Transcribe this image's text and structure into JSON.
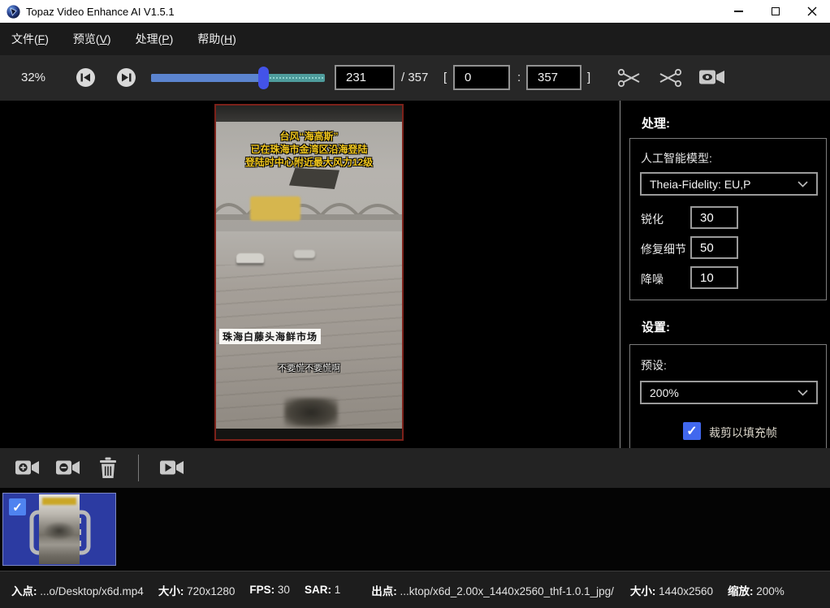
{
  "window": {
    "title": "Topaz Video Enhance AI V1.5.1"
  },
  "menu": {
    "items": [
      {
        "pre": "文件(",
        "key": "F",
        "post": ")"
      },
      {
        "pre": "预览(",
        "key": "V",
        "post": ")"
      },
      {
        "pre": "处理(",
        "key": "P",
        "post": ")"
      },
      {
        "pre": "帮助(",
        "key": "H",
        "post": ")"
      }
    ]
  },
  "toolbar": {
    "zoom_level": "32%",
    "current_frame": "231",
    "frame_total": "/ 357",
    "range_open": "[",
    "range_start": "0",
    "range_sep": ":",
    "range_end": "357",
    "range_close": "]"
  },
  "video_overlay": {
    "title_line1": "台风“海高斯”",
    "title_line2": "已在珠海市金湾区沿海登陆",
    "title_line3": "登陆时中心附近最大风力12级",
    "location_tag": "珠海白藤头海鲜市场",
    "caption": "不要慌不要慌啊"
  },
  "panel": {
    "processing_header": "处理:",
    "ai_model_label": "人工智能模型:",
    "ai_model_value": "Theia-Fidelity: EU,P",
    "params": [
      {
        "label": "锐化",
        "value": "30"
      },
      {
        "label": "修复细节",
        "value": "50"
      },
      {
        "label": "降噪",
        "value": "10"
      }
    ],
    "settings_header": "设置:",
    "preset_label": "预设:",
    "preset_value": "200%",
    "crop_to_fill_label": "裁剪以填充帧",
    "crop_to_fill_checked": true
  },
  "statusbar": {
    "fields": [
      {
        "label": "入点:",
        "value": " ...o/Desktop/x6d.mp4"
      },
      {
        "label": "大小:",
        "value": " 720x1280"
      },
      {
        "label": "FPS:",
        "value": " 30"
      },
      {
        "label": "SAR:",
        "value": " 1"
      },
      {
        "label": "出点:",
        "value": " ...ktop/x6d_2.00x_1440x2560_thf-1.0.1_jpg/"
      },
      {
        "label": "大小:",
        "value": " 1440x2560"
      },
      {
        "label": "缩放:",
        "value": " 200%"
      }
    ]
  },
  "icons": {
    "logo": "topaz-shield",
    "minimize": "–",
    "maximize": "▢",
    "close": "✕",
    "skip_back": "⏮",
    "skip_forward": "⏭",
    "trim_in_scissors": "✂",
    "trim_out_scissors": "✂",
    "preview_camera": "camera-eye",
    "add_video": "camera-plus",
    "remove_video": "camera-minus",
    "delete_video": "trash",
    "process_video": "camera-play",
    "dropdown_chevron": "⌄",
    "check": "✓"
  },
  "colors": {
    "accent_blue": "#4353e8",
    "checkbox_blue": "#4168ee",
    "slider_teal": "#4e9c9c",
    "slider_fill_blue": "#5b84cf",
    "selection_blue": "#2c3ba2",
    "video_border_red": "#7c211a"
  }
}
